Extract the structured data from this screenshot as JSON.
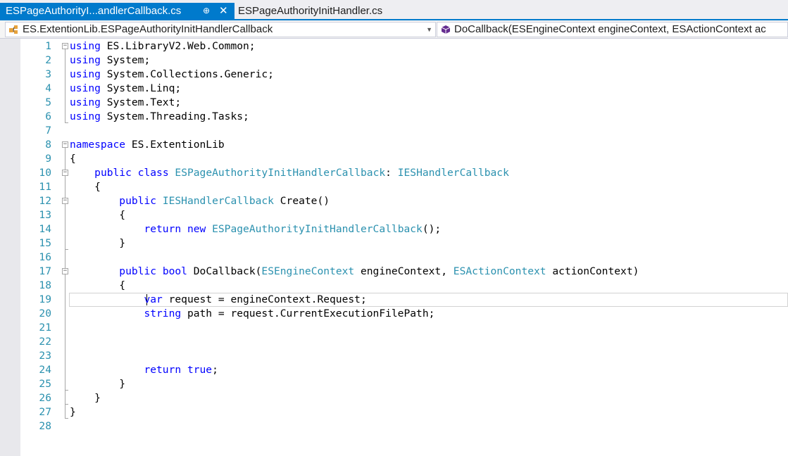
{
  "tabs": [
    {
      "label": "ESPageAuthorityI...andlerCallback.cs",
      "active": true,
      "pin_icon": "pin-icon",
      "close_icon": "close-icon"
    },
    {
      "label": "ESPageAuthorityInitHandler.cs",
      "active": false
    }
  ],
  "navbar": {
    "type_selector": "ES.ExtentionLib.ESPageAuthorityInitHandlerCallback",
    "member_selector": "DoCallback(ESEngineContext engineContext, ESActionContext ac"
  },
  "colors": {
    "accent": "#007acc",
    "keyword": "#0000ff",
    "type": "#2b91af",
    "line_number": "#2b91af"
  },
  "editor": {
    "lines": [
      {
        "n": "1",
        "tokens": [
          {
            "t": "using",
            "c": "kw"
          },
          {
            "t": " ES.LibraryV2.Web.Common;"
          }
        ]
      },
      {
        "n": "2",
        "tokens": [
          {
            "t": "using",
            "c": "kw"
          },
          {
            "t": " System;"
          }
        ]
      },
      {
        "n": "3",
        "tokens": [
          {
            "t": "using",
            "c": "kw"
          },
          {
            "t": " System.Collections.Generic;"
          }
        ]
      },
      {
        "n": "4",
        "tokens": [
          {
            "t": "using",
            "c": "kw"
          },
          {
            "t": " System.Linq;"
          }
        ]
      },
      {
        "n": "5",
        "tokens": [
          {
            "t": "using",
            "c": "kw"
          },
          {
            "t": " System.Text;"
          }
        ]
      },
      {
        "n": "6",
        "tokens": [
          {
            "t": "using",
            "c": "kw"
          },
          {
            "t": " System.Threading.Tasks;"
          }
        ]
      },
      {
        "n": "7",
        "tokens": []
      },
      {
        "n": "8",
        "tokens": [
          {
            "t": "namespace",
            "c": "kw"
          },
          {
            "t": " ES.ExtentionLib"
          }
        ]
      },
      {
        "n": "9",
        "tokens": [
          {
            "t": "{"
          }
        ]
      },
      {
        "n": "10",
        "tokens": [
          {
            "t": "    "
          },
          {
            "t": "public",
            "c": "kw"
          },
          {
            "t": " "
          },
          {
            "t": "class",
            "c": "kw"
          },
          {
            "t": " "
          },
          {
            "t": "ESPageAuthorityInitHandlerCallback",
            "c": "ty"
          },
          {
            "t": ": "
          },
          {
            "t": "IESHandlerCallback",
            "c": "ty"
          }
        ]
      },
      {
        "n": "11",
        "tokens": [
          {
            "t": "    {"
          }
        ]
      },
      {
        "n": "12",
        "tokens": [
          {
            "t": "        "
          },
          {
            "t": "public",
            "c": "kw"
          },
          {
            "t": " "
          },
          {
            "t": "IESHandlerCallback",
            "c": "ty"
          },
          {
            "t": " Create()"
          }
        ]
      },
      {
        "n": "13",
        "tokens": [
          {
            "t": "        {"
          }
        ]
      },
      {
        "n": "14",
        "tokens": [
          {
            "t": "            "
          },
          {
            "t": "return",
            "c": "kw"
          },
          {
            "t": " "
          },
          {
            "t": "new",
            "c": "kw"
          },
          {
            "t": " "
          },
          {
            "t": "ESPageAuthorityInitHandlerCallback",
            "c": "ty"
          },
          {
            "t": "();"
          }
        ]
      },
      {
        "n": "15",
        "tokens": [
          {
            "t": "        }"
          }
        ]
      },
      {
        "n": "16",
        "tokens": []
      },
      {
        "n": "17",
        "tokens": [
          {
            "t": "        "
          },
          {
            "t": "public",
            "c": "kw"
          },
          {
            "t": " "
          },
          {
            "t": "bool",
            "c": "kw"
          },
          {
            "t": " DoCallback("
          },
          {
            "t": "ESEngineContext",
            "c": "ty"
          },
          {
            "t": " engineContext, "
          },
          {
            "t": "ESActionContext",
            "c": "ty"
          },
          {
            "t": " actionContext)"
          }
        ]
      },
      {
        "n": "18",
        "tokens": [
          {
            "t": "        {"
          }
        ]
      },
      {
        "n": "19",
        "tokens": [
          {
            "t": "            "
          },
          {
            "t": "var",
            "c": "kw"
          },
          {
            "t": " request = engineContext.Request;"
          }
        ]
      },
      {
        "n": "20",
        "tokens": [
          {
            "t": "            "
          },
          {
            "t": "string",
            "c": "kw"
          },
          {
            "t": " path = request.CurrentExecutionFilePath;"
          }
        ]
      },
      {
        "n": "21",
        "tokens": []
      },
      {
        "n": "22",
        "tokens": []
      },
      {
        "n": "23",
        "tokens": []
      },
      {
        "n": "24",
        "tokens": [
          {
            "t": "            "
          },
          {
            "t": "return",
            "c": "kw"
          },
          {
            "t": " "
          },
          {
            "t": "true",
            "c": "kw"
          },
          {
            "t": ";"
          }
        ]
      },
      {
        "n": "25",
        "tokens": [
          {
            "t": "        }"
          }
        ]
      },
      {
        "n": "26",
        "tokens": [
          {
            "t": "    }"
          }
        ]
      },
      {
        "n": "27",
        "tokens": [
          {
            "t": "}"
          }
        ]
      },
      {
        "n": "28",
        "tokens": []
      }
    ]
  }
}
